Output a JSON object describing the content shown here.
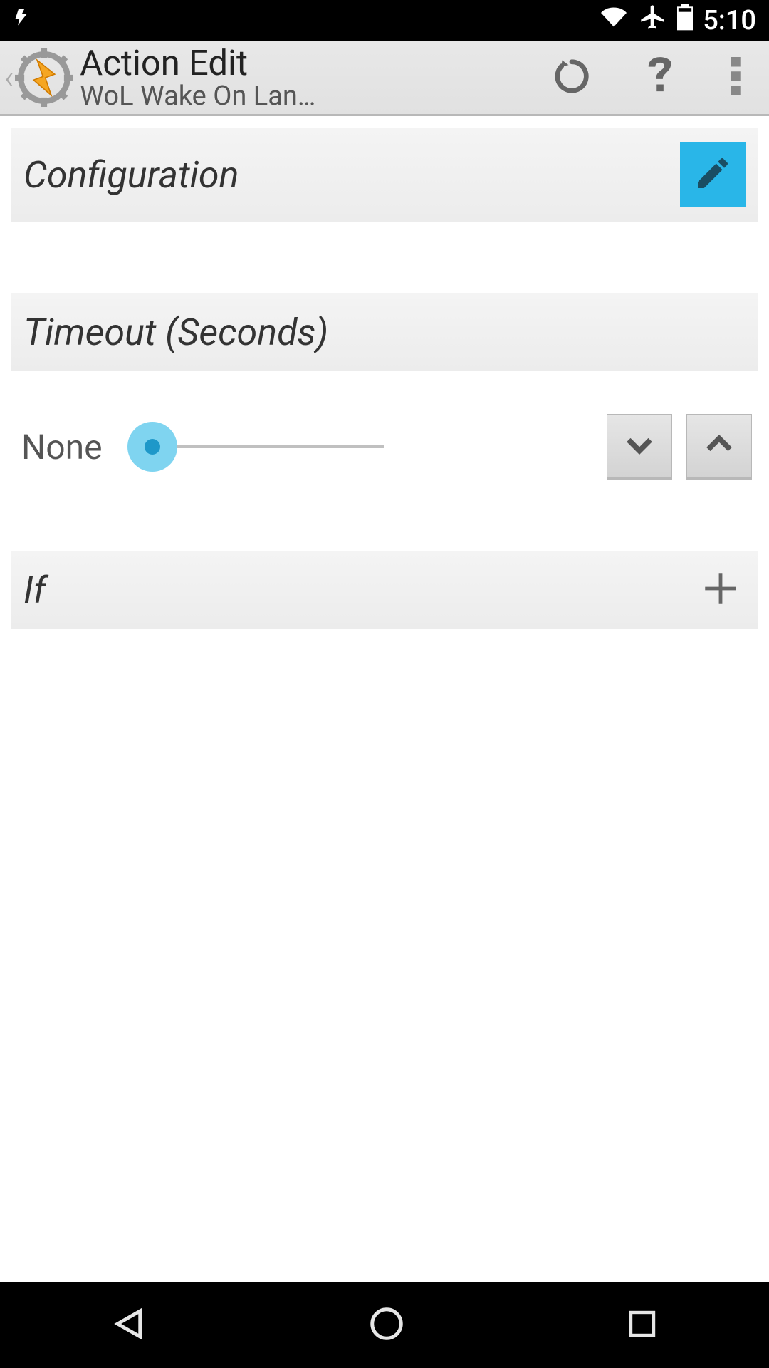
{
  "statusbar": {
    "time": "5:10"
  },
  "header": {
    "title": "Action Edit",
    "subtitle": "WoL Wake On Lan…"
  },
  "sections": {
    "configuration": {
      "label": "Configuration"
    },
    "timeout": {
      "label": "Timeout (Seconds)",
      "value": "None"
    },
    "if": {
      "label": "If"
    }
  }
}
